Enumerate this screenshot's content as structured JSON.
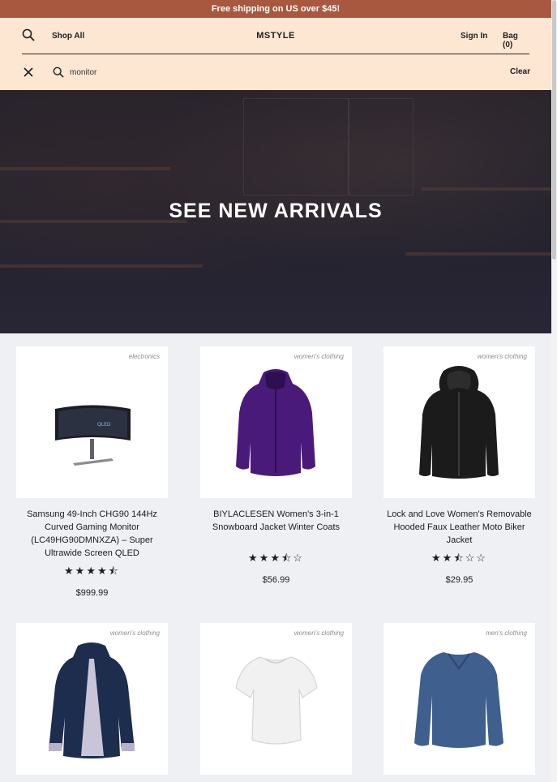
{
  "promo": {
    "text": "Free shipping on US over $45!"
  },
  "nav": {
    "search_icon": "search-icon",
    "shop_all": "Shop All",
    "brand": "MSTYLE",
    "sign_in": "Sign In",
    "bag": "Bag (0)"
  },
  "search": {
    "close_icon": "close-icon",
    "query": "monitor",
    "clear": "Clear"
  },
  "hero": {
    "title": "SEE NEW ARRIVALS"
  },
  "colors": {
    "promo_bg": "#a8583f",
    "header_bg": "#fde6d2",
    "page_bg": "#eef0f4"
  },
  "products": [
    {
      "category": "electronics",
      "name": "Samsung 49-Inch CHG90 144Hz Curved Gaming Monitor (LC49HG90DMNXZA) – Super Ultrawide Screen QLED",
      "stars": "★★★★⯪",
      "rating": 4.5,
      "price": "$999.99"
    },
    {
      "category": "women's clothing",
      "name": "BIYLACLESEN Women's 3-in-1 Snowboard Jacket Winter Coats",
      "stars": "★★★⯪☆",
      "rating": 3.5,
      "price": "$56.99"
    },
    {
      "category": "women's clothing",
      "name": "Lock and Love Women's Removable Hooded Faux Leather Moto Biker Jacket",
      "stars": "★★⯪☆☆",
      "rating": 2.5,
      "price": "$29.95"
    },
    {
      "category": "women's clothing",
      "name": "",
      "stars": "",
      "price": ""
    },
    {
      "category": "women's clothing",
      "name": "",
      "stars": "",
      "price": ""
    },
    {
      "category": "men's clothing",
      "name": "",
      "stars": "",
      "price": ""
    }
  ]
}
